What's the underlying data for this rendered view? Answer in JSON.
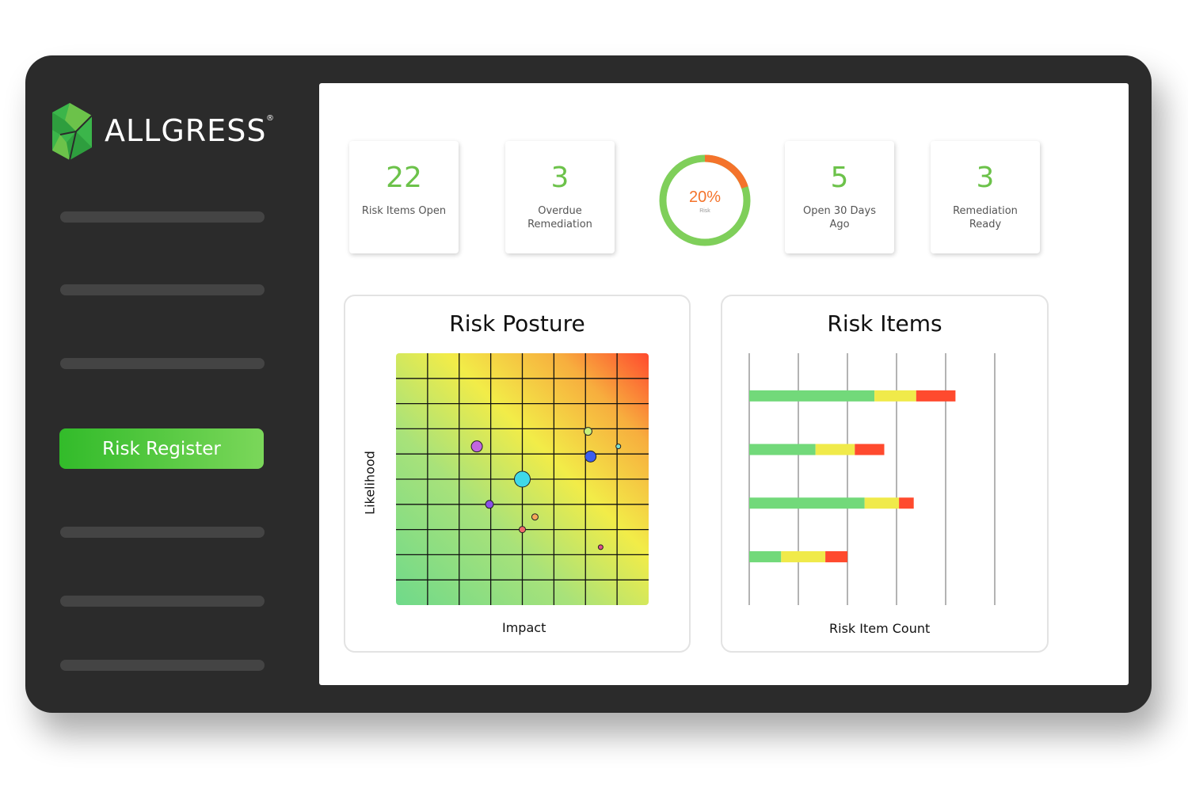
{
  "brand": {
    "name": "ALLGRESS",
    "registered": "®",
    "logo_colors": [
      "#3bb54a",
      "#6cc24a",
      "#2e9e3e"
    ]
  },
  "sidebar": {
    "active_item": {
      "label": "Risk Register"
    },
    "placeholder_items": 6
  },
  "kpis": [
    {
      "value": "22",
      "label": "Risk Items Open"
    },
    {
      "value": "3",
      "label": "Overdue Remediation"
    },
    {
      "value": "5",
      "label": "Open 30 Days Ago"
    },
    {
      "value": "3",
      "label": "Remediation Ready"
    }
  ],
  "risk_gauge": {
    "value_text": "20%",
    "label": "Risk",
    "fraction": 0.2,
    "colors": {
      "risk": "#f4732b",
      "rest": "#7fcf5a"
    }
  },
  "risk_posture": {
    "title": "Risk Posture",
    "x_label": "Impact",
    "y_label": "Likelihood"
  },
  "risk_items": {
    "title": "Risk Items",
    "x_label": "Risk Item Count"
  },
  "chart_data": [
    {
      "type": "scatter",
      "title": "Risk Posture",
      "xlabel": "Impact",
      "ylabel": "Likelihood",
      "xlim": [
        0,
        10
      ],
      "ylim": [
        0,
        10
      ],
      "grid": true,
      "points": [
        {
          "x": 3.2,
          "y": 6.3,
          "size": 7,
          "color": "#c266e0"
        },
        {
          "x": 7.6,
          "y": 6.9,
          "size": 5,
          "color": "#c8f07a"
        },
        {
          "x": 8.8,
          "y": 6.3,
          "size": 3,
          "color": "#7be0d2"
        },
        {
          "x": 7.7,
          "y": 5.9,
          "size": 7,
          "color": "#3c5ef0"
        },
        {
          "x": 5.0,
          "y": 5.0,
          "size": 10,
          "color": "#3fd9e8"
        },
        {
          "x": 3.7,
          "y": 4.0,
          "size": 5,
          "color": "#8a4ee8"
        },
        {
          "x": 5.5,
          "y": 3.5,
          "size": 4,
          "color": "#f5a85a"
        },
        {
          "x": 5.0,
          "y": 3.0,
          "size": 4,
          "color": "#f06a6a"
        },
        {
          "x": 8.1,
          "y": 2.3,
          "size": 3,
          "color": "#e04e8a"
        }
      ]
    },
    {
      "type": "bar",
      "title": "Risk Items",
      "xlabel": "Risk Item Count",
      "orientation": "horizontal",
      "stacked": true,
      "xlim": [
        0,
        10
      ],
      "gridlines": [
        0,
        2,
        4,
        6,
        8,
        10
      ],
      "segment_colors": [
        "#72d97a",
        "#f0ea4a",
        "#ff4a2e"
      ],
      "bars": [
        {
          "segments": [
            5.1,
            1.7,
            1.6
          ]
        },
        {
          "segments": [
            2.7,
            1.6,
            1.2
          ]
        },
        {
          "segments": [
            4.7,
            1.4,
            0.6
          ]
        },
        {
          "segments": [
            1.3,
            1.8,
            0.9
          ]
        }
      ]
    }
  ]
}
